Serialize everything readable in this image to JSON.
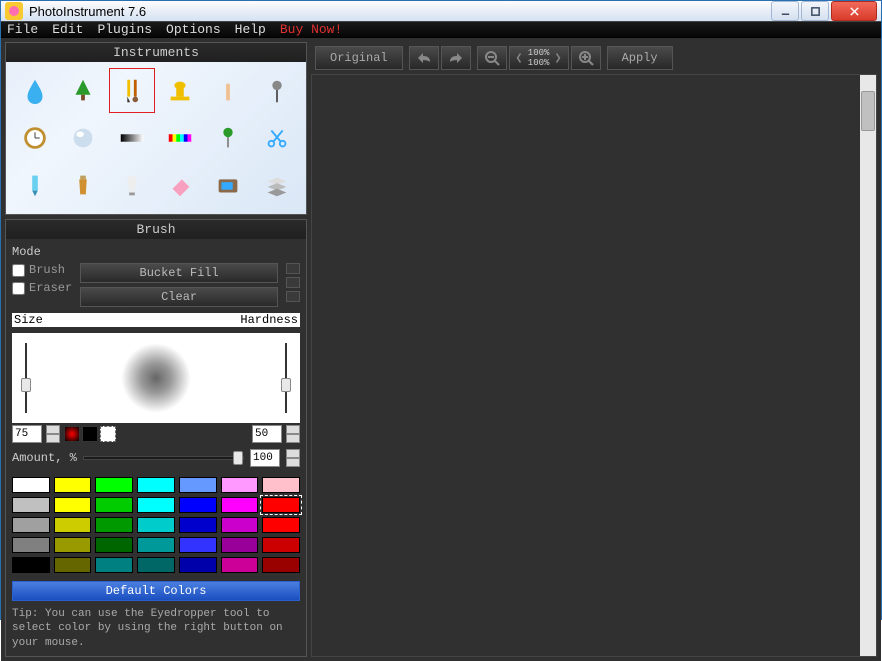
{
  "app": {
    "title": "PhotoInstrument 7.6"
  },
  "menu": {
    "file": "File",
    "edit": "Edit",
    "plugins": "Plugins",
    "options": "Options",
    "help": "Help",
    "buy_now": "Buy Now!"
  },
  "instruments": {
    "title": "Instruments",
    "items": [
      "drop",
      "tree",
      "brush",
      "stamp",
      "finger",
      "pin",
      "clock",
      "sphere",
      "gradient",
      "rainbow",
      "pushpin",
      "scissors",
      "marker",
      "bottle",
      "bulb",
      "eraser",
      "tv",
      "layers"
    ],
    "selected_index": 2
  },
  "brush_panel": {
    "title": "Brush",
    "mode_label": "Mode",
    "brush_check": "Brush",
    "eraser_check": "Eraser",
    "bucket_fill": "Bucket Fill",
    "clear": "Clear",
    "size_label": "Size",
    "hardness_label": "Hardness",
    "size_value": "75",
    "hardness_value": "50",
    "amount_label": "Amount, %",
    "amount_value": "100",
    "default_colors": "Default Colors",
    "tip": "Tip: You can use the Eyedropper tool to select color by using the right button on your mouse."
  },
  "palette": {
    "active_index": 13,
    "colors": [
      "#ffffff",
      "#ffff00",
      "#00ff00",
      "#00ffff",
      "#6699ff",
      "#ff99ff",
      "#ffc0cb",
      "#c0c0c0",
      "#ffff00",
      "#00cc00",
      "#00ffff",
      "#0000ff",
      "#ff00ff",
      "#ff0000",
      "#a0a0a0",
      "#cccc00",
      "#009900",
      "#00cccc",
      "#0000cc",
      "#cc00cc",
      "#ff0000",
      "#808080",
      "#999900",
      "#006600",
      "#009999",
      "#3333ff",
      "#990099",
      "#cc0000",
      "#000000",
      "#666600",
      "#008080",
      "#006666",
      "#0000aa",
      "#cc0099",
      "#990000"
    ]
  },
  "toolbar": {
    "original": "Original",
    "apply": "Apply",
    "zoom_text": "100%\n100%"
  }
}
